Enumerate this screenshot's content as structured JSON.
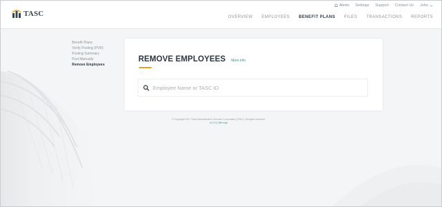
{
  "brand": {
    "name": "TASC",
    "accent": "#e8a31e",
    "link": "#3d8e8a"
  },
  "utility_nav": {
    "alerts": "Alerts",
    "settings": "Settings",
    "support": "Support",
    "contact": "Contact Us",
    "user": "John"
  },
  "main_nav": {
    "items": [
      {
        "label": "OVERVIEW"
      },
      {
        "label": "EMPLOYEES"
      },
      {
        "label": "BENEFIT PLANS"
      },
      {
        "label": "FILES"
      },
      {
        "label": "TRANSACTIONS"
      },
      {
        "label": "REPORTS"
      }
    ],
    "active": "BENEFIT PLANS"
  },
  "sidebar": {
    "items": [
      {
        "label": "Benefit Plans"
      },
      {
        "label": "Verify Posting (PVR)"
      },
      {
        "label": "Posting Summary"
      },
      {
        "label": "Post Manually"
      },
      {
        "label": "Remove Employees"
      }
    ],
    "current": "Remove Employees"
  },
  "card": {
    "title": "REMOVE EMPLOYEES",
    "more_info": "More info",
    "search_placeholder": "Employee Name or TASC ID",
    "search_value": ""
  },
  "footer": {
    "line1": "© Copyright 2017 Total Administrative Services Corporation (TASC). All rights reserved.",
    "line2": "v1.0.0 | Site map"
  }
}
